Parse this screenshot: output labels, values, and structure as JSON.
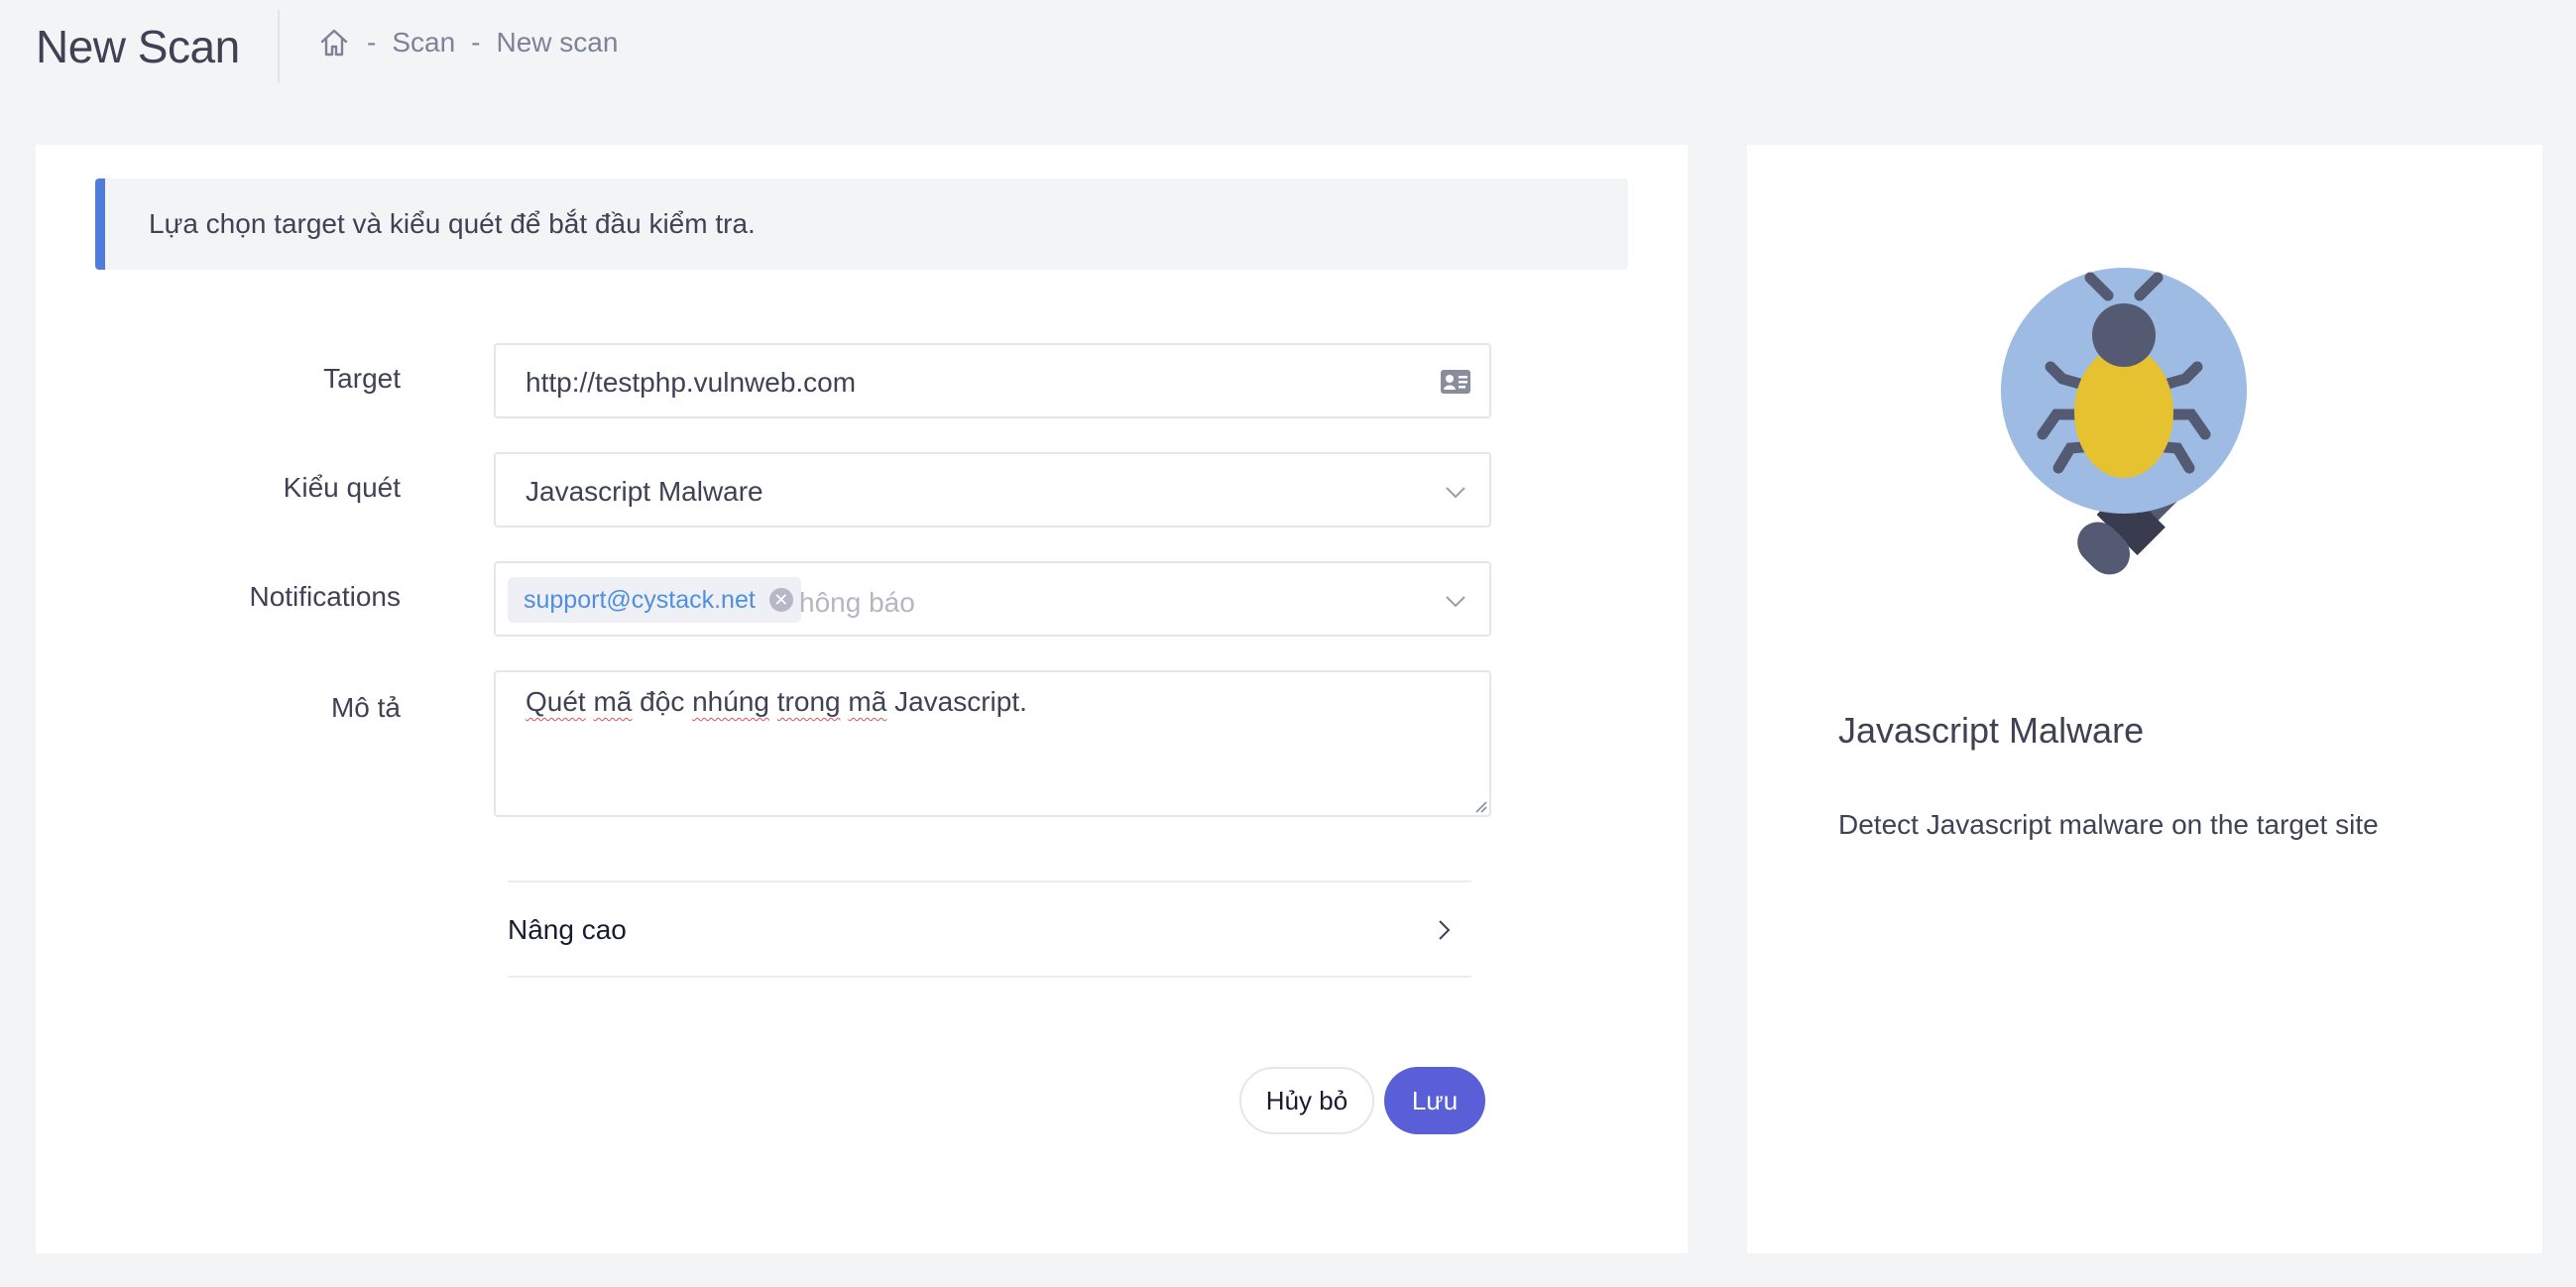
{
  "header": {
    "title": "New Scan",
    "breadcrumb": [
      "Scan",
      "New scan"
    ],
    "separator": "-"
  },
  "form": {
    "notice": "Lựa chọn target và kiểu quét để bắt đầu kiểm tra.",
    "target_label": "Target",
    "target_value": "http://testphp.vulnweb.com",
    "scan_type_label": "Kiểu quét",
    "scan_type_value": "Javascript Malware",
    "notifications_label": "Notifications",
    "notification_tag": "support@cystack.net",
    "notifications_placeholder": "hông báo",
    "description_label": "Mô tả",
    "description_words": [
      "Quét",
      "mã",
      "độc",
      "nhúng",
      "trong",
      "mã",
      "Javascript."
    ],
    "advanced_label": "Nâng cao",
    "cancel_label": "Hủy bỏ",
    "save_label": "Lưu"
  },
  "info": {
    "title": "Javascript Malware",
    "description": "Detect Javascript malware on the target site"
  },
  "colors": {
    "accent": "#4e7cd8",
    "primary_button": "#5a5fd8",
    "tag_text": "#4e8fe0",
    "illustration_circle": "#9dbbe3",
    "illustration_bug": "#e6c230",
    "illustration_dark": "#555a73"
  },
  "icons": [
    "home-icon",
    "contact-card-icon",
    "chevron-down-icon",
    "clear-tag-icon",
    "chevron-right-icon",
    "bug-magnifier-illustration"
  ]
}
